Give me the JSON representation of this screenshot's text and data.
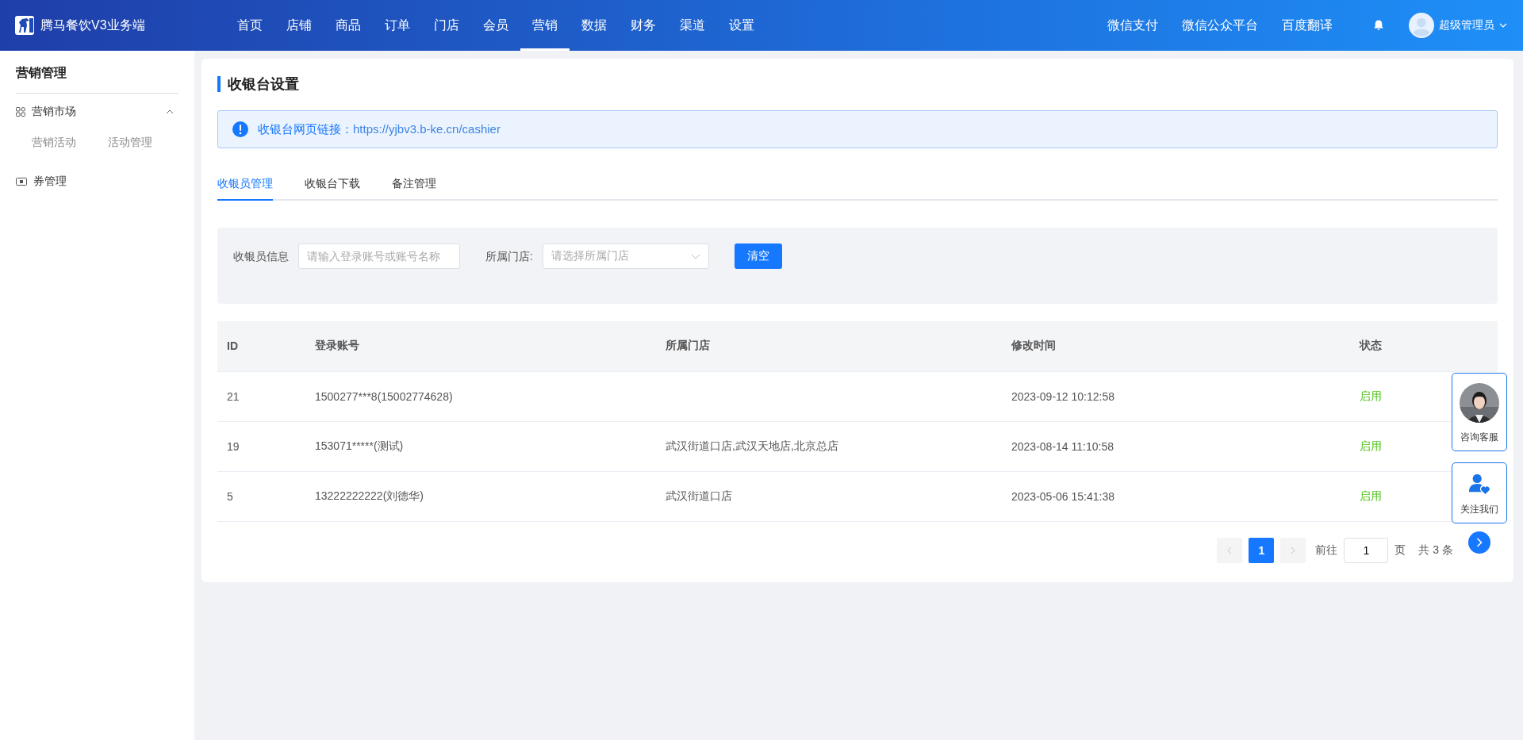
{
  "brand": {
    "title": "腾马餐饮V3业务端"
  },
  "nav": [
    {
      "label": "首页",
      "selected": false
    },
    {
      "label": "店铺",
      "selected": false
    },
    {
      "label": "商品",
      "selected": false
    },
    {
      "label": "订单",
      "selected": false
    },
    {
      "label": "门店",
      "selected": false
    },
    {
      "label": "会员",
      "selected": false
    },
    {
      "label": "营销",
      "selected": true
    },
    {
      "label": "数据",
      "selected": false
    },
    {
      "label": "财务",
      "selected": false
    },
    {
      "label": "渠道",
      "selected": false
    },
    {
      "label": "设置",
      "selected": false
    }
  ],
  "top_links": [
    "微信支付",
    "微信公众平台",
    "百度翻译"
  ],
  "user": {
    "name": "超级管理员"
  },
  "sidebar": {
    "title": "营销管理",
    "groups": [
      {
        "label": "营销市场",
        "kind": "grid",
        "expanded": true,
        "children": [
          {
            "label": "营销活动"
          },
          {
            "label": "活动管理"
          }
        ]
      },
      {
        "label": "券管理",
        "kind": "ticket"
      }
    ]
  },
  "page": {
    "title": "收银台设置",
    "alert": {
      "label": "收银台网页链接：",
      "url": "https://yjbv3.b-ke.cn/cashier"
    }
  },
  "tabs": [
    {
      "label": "收银员管理",
      "selected": true
    },
    {
      "label": "收银台下载",
      "selected": false
    },
    {
      "label": "备注管理",
      "selected": false
    }
  ],
  "filter": {
    "info_label": "收银员信息",
    "info_placeholder": "请输入登录账号或账号名称",
    "store_label": "所属门店:",
    "store_placeholder": "请选择所属门店",
    "clear_button": "清空"
  },
  "table": {
    "columns": [
      "ID",
      "登录账号",
      "所属门店",
      "修改时间",
      "状态"
    ],
    "rows": [
      {
        "id": "21",
        "account": "1500277***8(15002774628)",
        "time": "2023-09-12 10:12:58",
        "status": "启用",
        "enabled": true
      },
      {
        "id": "19",
        "account": "153071*****(测试)",
        "stores": "武汉街道口店,武汉天地店,北京总店",
        "time": "2023-08-14 11:10:58",
        "status": "启用",
        "enabled": true
      },
      {
        "id": "5",
        "account": "13222222222(刘德华)",
        "stores": "武汉街道口店",
        "time": "2023-05-06 15:41:38",
        "status": "启用",
        "enabled": true
      }
    ]
  },
  "pagination": {
    "pages": [
      {
        "label": "1",
        "selected": true
      }
    ],
    "goto_label": "前往",
    "goto_value": "1",
    "page_unit": "页",
    "total": "共 3 条"
  },
  "float_buttons": [
    {
      "label": "咨询客服",
      "kind": "service"
    },
    {
      "label": "关注我们",
      "kind": "follow"
    }
  ]
}
